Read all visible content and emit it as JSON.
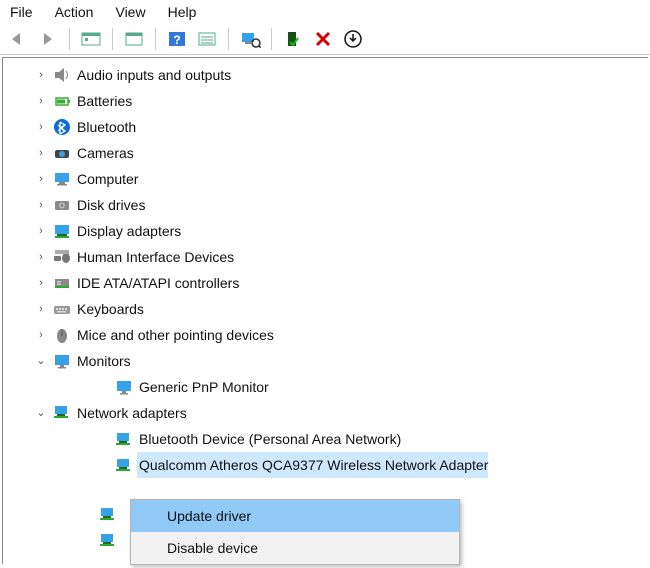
{
  "menu": {
    "file": "File",
    "action": "Action",
    "view": "View",
    "help": "Help"
  },
  "tree": {
    "items": [
      {
        "expander": "›",
        "icon": "audio",
        "label": "Audio inputs and outputs"
      },
      {
        "expander": "›",
        "icon": "battery",
        "label": "Batteries"
      },
      {
        "expander": "›",
        "icon": "bluetooth",
        "label": "Bluetooth"
      },
      {
        "expander": "›",
        "icon": "camera",
        "label": "Cameras"
      },
      {
        "expander": "›",
        "icon": "computer",
        "label": "Computer"
      },
      {
        "expander": "›",
        "icon": "disk",
        "label": "Disk drives"
      },
      {
        "expander": "›",
        "icon": "display",
        "label": "Display adapters"
      },
      {
        "expander": "›",
        "icon": "hid",
        "label": "Human Interface Devices"
      },
      {
        "expander": "›",
        "icon": "ide",
        "label": "IDE ATA/ATAPI controllers"
      },
      {
        "expander": "›",
        "icon": "keyboard",
        "label": "Keyboards"
      },
      {
        "expander": "›",
        "icon": "mouse",
        "label": "Mice and other pointing devices"
      },
      {
        "expander": "v",
        "icon": "monitor",
        "label": "Monitors"
      },
      {
        "expander": "",
        "icon": "monitor",
        "label": "Generic PnP Monitor",
        "indent": 2
      },
      {
        "expander": "v",
        "icon": "network",
        "label": "Network adapters"
      },
      {
        "expander": "",
        "icon": "net-item",
        "label": "Bluetooth Device (Personal Area Network)",
        "indent": 2
      },
      {
        "expander": "",
        "icon": "net-item",
        "label": "Qualcomm Atheros QCA9377 Wireless Network Adapter",
        "indent": 2,
        "selected": true
      }
    ]
  },
  "context_menu": {
    "items": [
      {
        "label": "Update driver",
        "highlight": true
      },
      {
        "label": "Disable device",
        "highlight": false
      }
    ]
  }
}
